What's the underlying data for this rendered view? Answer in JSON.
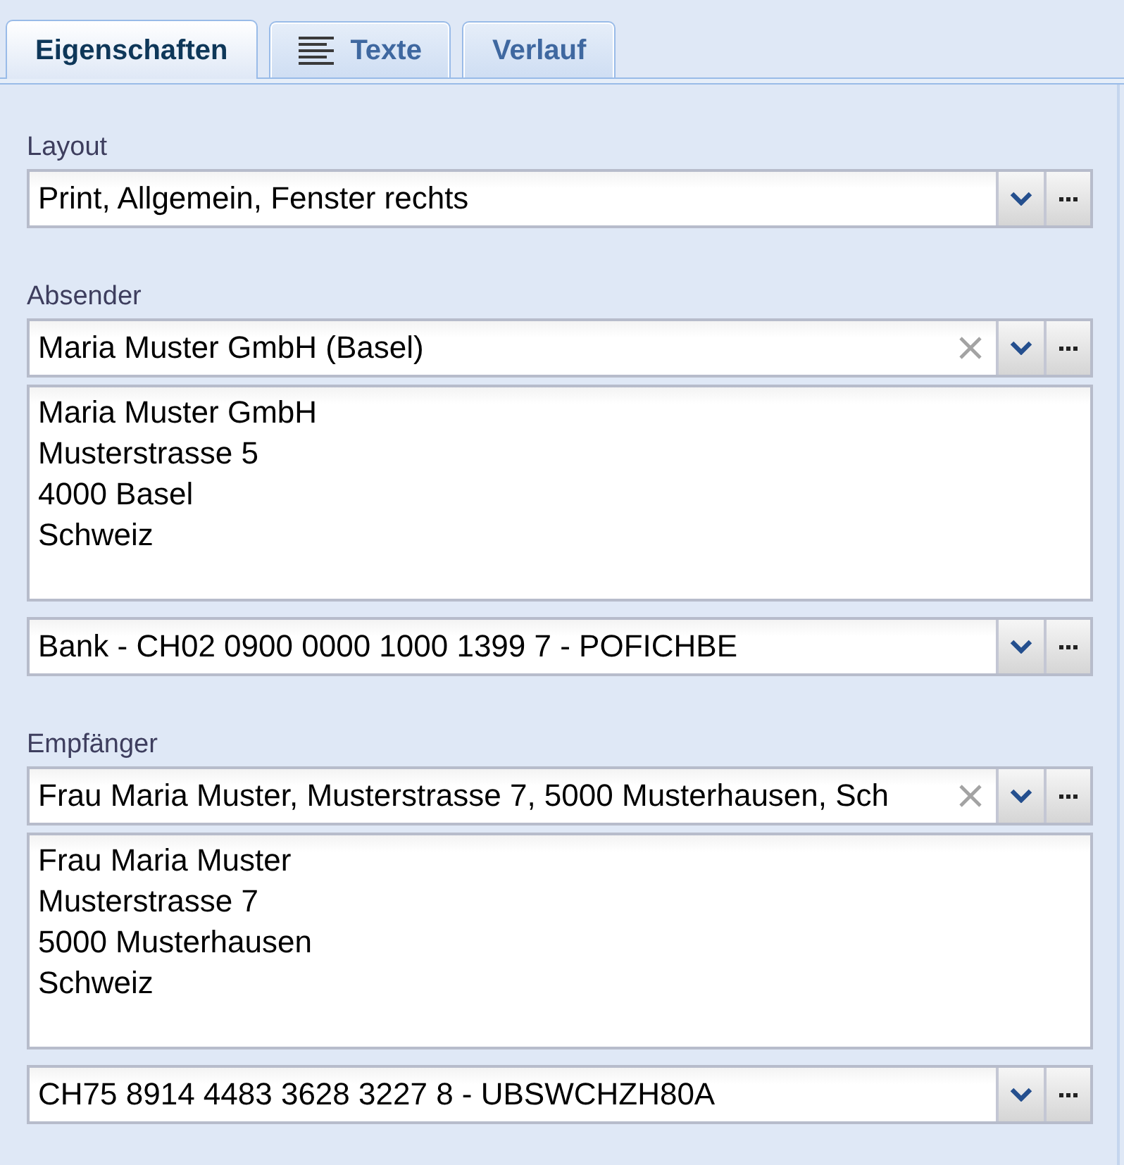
{
  "tabs": [
    {
      "label": "Eigenschaften",
      "selected": true,
      "kind": "plain"
    },
    {
      "label": "Texte",
      "selected": false,
      "kind": "with_icon"
    },
    {
      "label": "Verlauf",
      "selected": false,
      "kind": "plain"
    }
  ],
  "sections": [
    {
      "label": "Layout",
      "fields": [
        {
          "kind": "combo",
          "value": "Print, Allgemein, Fenster rechts",
          "clearable": false
        }
      ]
    },
    {
      "label": "Absender",
      "fields": [
        {
          "kind": "combo",
          "value": "Maria Muster GmbH (Basel)",
          "clearable": true
        },
        {
          "kind": "address",
          "lines": [
            "Maria Muster GmbH",
            "Musterstrasse 5",
            "4000 Basel",
            "Schweiz"
          ]
        },
        {
          "kind": "combo",
          "value": "Bank - CH02 0900 0000 1000 1399 7 - POFICHBE",
          "clearable": false
        }
      ]
    },
    {
      "label": "Empfänger",
      "fields": [
        {
          "kind": "combo",
          "value": "Frau Maria Muster, Musterstrasse 7, 5000 Musterhausen, Sch",
          "clearable": true
        },
        {
          "kind": "address",
          "lines": [
            "Frau Maria Muster",
            "Musterstrasse 7",
            "5000 Musterhausen",
            "Schweiz"
          ]
        },
        {
          "kind": "combo",
          "value": "CH75 8914 4483 3628 3227 8 - UBSWCHZH80A",
          "clearable": false
        }
      ]
    }
  ]
}
